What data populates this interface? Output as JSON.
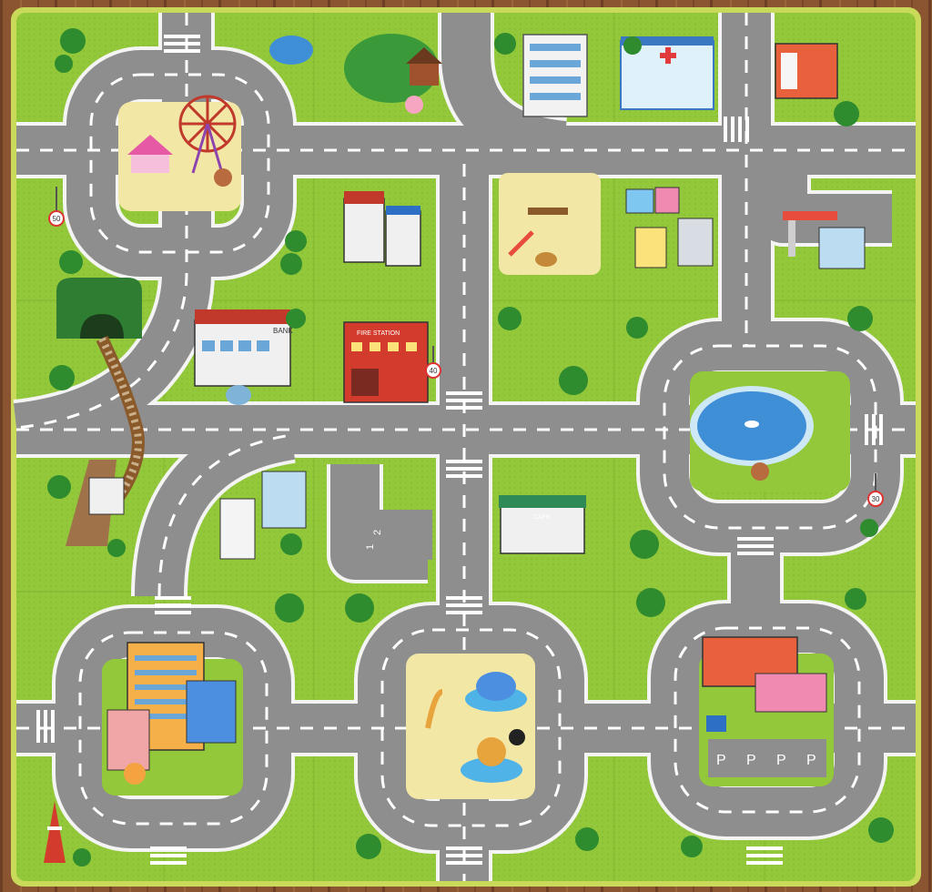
{
  "photo": {
    "subject": "Interlocking foam puzzle play mat with a city road map"
  },
  "signs": {
    "bank": "BANK",
    "fire_station": "FIRE STATION",
    "cafe": "CAFE",
    "speed_50": "50",
    "speed_40": "40",
    "speed_30": "30",
    "parking_1": "1",
    "parking_2": "2",
    "parking_p": "P"
  },
  "colors": {
    "floor_wood": "#8a5530",
    "mat_green": "#92c83a",
    "road_gray": "#8e8e8e",
    "road_edge": "#f4f4f4",
    "mat_border": "#c8d858",
    "pond_blue": "#3f8fd6",
    "sand": "#f3e7a6"
  }
}
